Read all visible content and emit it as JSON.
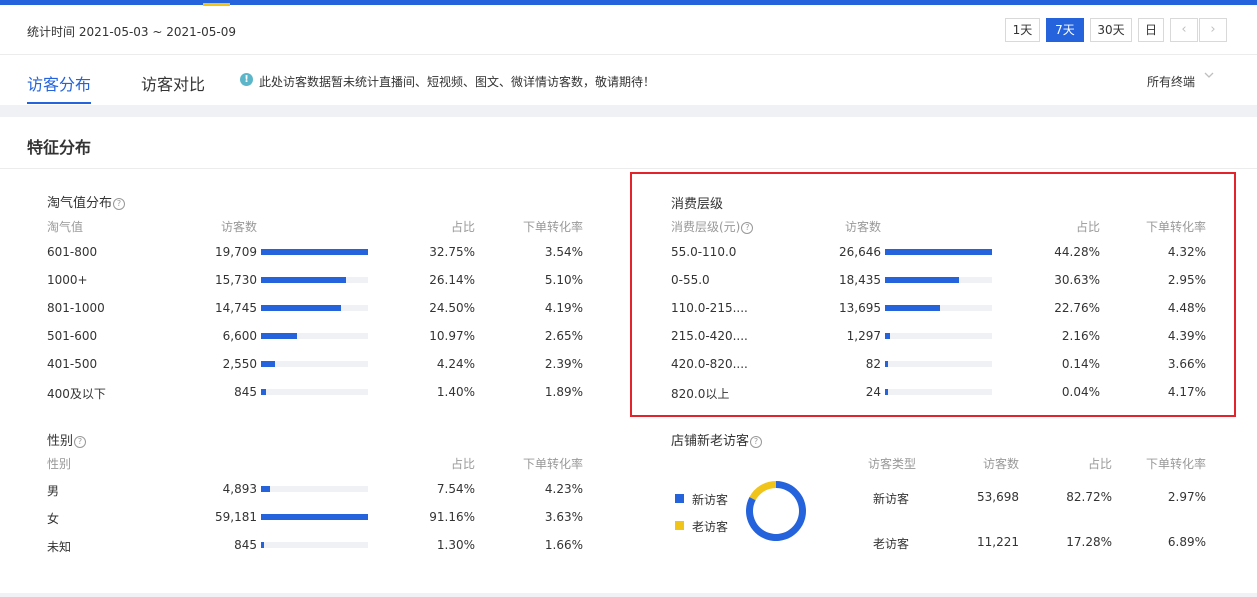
{
  "header": {
    "date_range_label": "统计时间 2021-05-03 ~ 2021-05-09",
    "range_buttons": [
      "1天",
      "7天",
      "30天",
      "日"
    ],
    "active_range": "7天",
    "prev_glyph": "‹",
    "next_glyph": "›"
  },
  "tabs": {
    "items": [
      "访客分布",
      "访客对比"
    ],
    "active": "访客分布",
    "notice": "此处访客数据暂未统计直播间、短视频、图文、微详情访客数，敬请期待！",
    "terminal_select": "所有终端"
  },
  "section_title": "特征分布",
  "colors": {
    "accent": "#2463dc",
    "highlight_box": "#e1242c",
    "old_visitor": "#f0c419"
  },
  "taoqi": {
    "title": "淘气值分布",
    "headers": [
      "淘气值",
      "访客数",
      "占比",
      "下单转化率"
    ],
    "rows": [
      {
        "label": "601-800",
        "visitors": "19,709",
        "share": "32.75%",
        "conv": "3.54%",
        "pct": 32.75
      },
      {
        "label": "1000+",
        "visitors": "15,730",
        "share": "26.14%",
        "conv": "5.10%",
        "pct": 26.14
      },
      {
        "label": "801-1000",
        "visitors": "14,745",
        "share": "24.50%",
        "conv": "4.19%",
        "pct": 24.5
      },
      {
        "label": "501-600",
        "visitors": "6,600",
        "share": "10.97%",
        "conv": "2.65%",
        "pct": 10.97
      },
      {
        "label": "401-500",
        "visitors": "2,550",
        "share": "4.24%",
        "conv": "2.39%",
        "pct": 4.24
      },
      {
        "label": "400及以下",
        "visitors": "845",
        "share": "1.40%",
        "conv": "1.89%",
        "pct": 1.4
      }
    ]
  },
  "consumption": {
    "title": "消费层级",
    "headers": [
      "消费层级(元)",
      "访客数",
      "占比",
      "下单转化率"
    ],
    "rows": [
      {
        "label": "55.0-110.0",
        "visitors": "26,646",
        "share": "44.28%",
        "conv": "4.32%",
        "pct": 44.28
      },
      {
        "label": "0-55.0",
        "visitors": "18,435",
        "share": "30.63%",
        "conv": "2.95%",
        "pct": 30.63
      },
      {
        "label": "110.0-215....",
        "visitors": "13,695",
        "share": "22.76%",
        "conv": "4.48%",
        "pct": 22.76
      },
      {
        "label": "215.0-420....",
        "visitors": "1,297",
        "share": "2.16%",
        "conv": "4.39%",
        "pct": 2.16
      },
      {
        "label": "420.0-820....",
        "visitors": "82",
        "share": "0.14%",
        "conv": "3.66%",
        "pct": 0.14
      },
      {
        "label": "820.0以上",
        "visitors": "24",
        "share": "0.04%",
        "conv": "4.17%",
        "pct": 0.04
      }
    ]
  },
  "gender": {
    "title": "性别",
    "headers": [
      "性别",
      "占比",
      "下单转化率"
    ],
    "rows": [
      {
        "label": "男",
        "visitors": "4,893",
        "share": "7.54%",
        "conv": "4.23%",
        "pct": 7.54
      },
      {
        "label": "女",
        "visitors": "59,181",
        "share": "91.16%",
        "conv": "3.63%",
        "pct": 91.16
      },
      {
        "label": "未知",
        "visitors": "845",
        "share": "1.30%",
        "conv": "1.66%",
        "pct": 1.3
      }
    ]
  },
  "new_old": {
    "title": "店铺新老访客",
    "legend": [
      "新访客",
      "老访客"
    ],
    "headers": [
      "访客类型",
      "访客数",
      "占比",
      "下单转化率"
    ],
    "rows": [
      {
        "type": "新访客",
        "visitors": "53,698",
        "share": "82.72%",
        "conv": "2.97%",
        "pct": 82.72
      },
      {
        "type": "老访客",
        "visitors": "11,221",
        "share": "17.28%",
        "conv": "6.89%",
        "pct": 17.28
      }
    ]
  }
}
